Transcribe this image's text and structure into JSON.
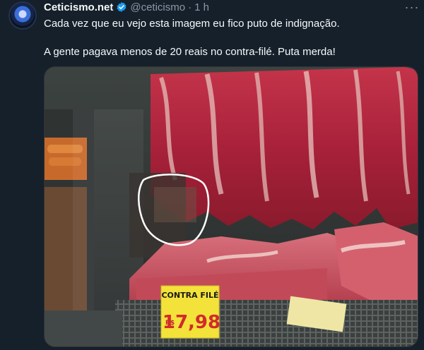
{
  "tweet": {
    "author_name": "Ceticismo.net",
    "author_handle": "@ceticismo",
    "separator": "·",
    "time": "1 h",
    "text_line1": "Cada vez que eu vejo esta imagem eu fico puto de indignação.",
    "text_line2": "A gente pagava menos de 20 reais no contra-filé. Puta merda!",
    "more_label": "···"
  },
  "media": {
    "price_sign_label": "CONTRA FILÉ",
    "price_currency": "R$",
    "price_value": "17,98"
  },
  "colors": {
    "background": "#15202b",
    "text_primary": "#f7f9f9",
    "text_secondary": "#8b98a5",
    "verified_badge": "#1d9bf0",
    "price_sign": "#f3e23a"
  },
  "icons": [
    "verified-badge-icon",
    "more-options-icon"
  ]
}
